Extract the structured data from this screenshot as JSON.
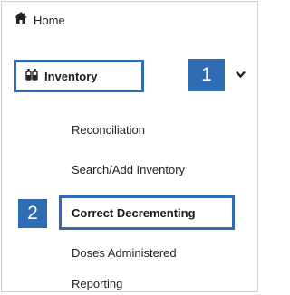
{
  "nav": {
    "home": {
      "label": "Home",
      "icon": "home-icon"
    },
    "inventory": {
      "label": "Inventory",
      "icon": "bottles-icon",
      "expanded": true
    },
    "expand_icon": "chevron-down-icon",
    "subitems": [
      {
        "label": "Reconciliation"
      },
      {
        "label": "Search/Add Inventory"
      },
      {
        "label": "Correct Decrementing"
      },
      {
        "label": "Doses Administered"
      },
      {
        "label": "Reporting"
      }
    ]
  },
  "callouts": {
    "step1": "1",
    "step2": "2",
    "color": "#2e6db4"
  }
}
